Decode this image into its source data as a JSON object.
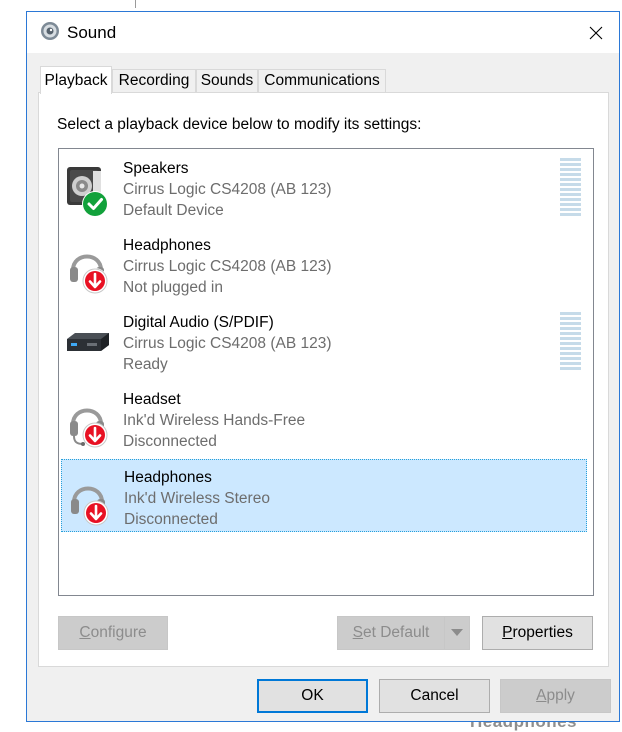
{
  "window": {
    "title": "Sound"
  },
  "tabs": [
    {
      "label": "Playback",
      "active": true
    },
    {
      "label": "Recording"
    },
    {
      "label": "Sounds"
    },
    {
      "label": "Communications"
    }
  ],
  "instruction": "Select a playback device below to modify its settings:",
  "devices": [
    {
      "name": "Speakers",
      "description": "Cirrus Logic CS4208 (AB 123)",
      "status": "Default Device",
      "icon": "speaker-icon",
      "badge": "check-badge-icon",
      "has_meter": true
    },
    {
      "name": "Headphones",
      "description": "Cirrus Logic CS4208 (AB 123)",
      "status": "Not plugged in",
      "icon": "headphones-icon",
      "badge": "down-arrow-badge-icon",
      "has_meter": false
    },
    {
      "name": "Digital Audio (S/PDIF)",
      "description": "Cirrus Logic CS4208 (AB 123)",
      "status": "Ready",
      "icon": "digital-audio-icon",
      "badge": "",
      "has_meter": true
    },
    {
      "name": "Headset",
      "description": "Ink'd Wireless Hands-Free",
      "status": "Disconnected",
      "icon": "headset-icon",
      "badge": "down-arrow-badge-icon",
      "has_meter": false
    },
    {
      "name": "Headphones",
      "description": "Ink'd Wireless Stereo",
      "status": "Disconnected",
      "icon": "headphones-icon",
      "badge": "down-arrow-badge-icon",
      "has_meter": false,
      "selected": true
    }
  ],
  "buttons": {
    "configure": {
      "mnemonic": "C",
      "rest": "onfigure"
    },
    "set_default": {
      "mnemonic": "S",
      "rest": "et Default"
    },
    "properties": {
      "mnemonic": "P",
      "rest": "roperties"
    },
    "ok": "OK",
    "cancel": "Cancel",
    "apply": {
      "mnemonic": "A",
      "rest": "pply"
    }
  },
  "background_peek": "Headphones",
  "colors": {
    "accent": "#0078d7",
    "selection": "#cce8ff",
    "check_green": "#12a13b",
    "badge_red": "#e81123"
  }
}
